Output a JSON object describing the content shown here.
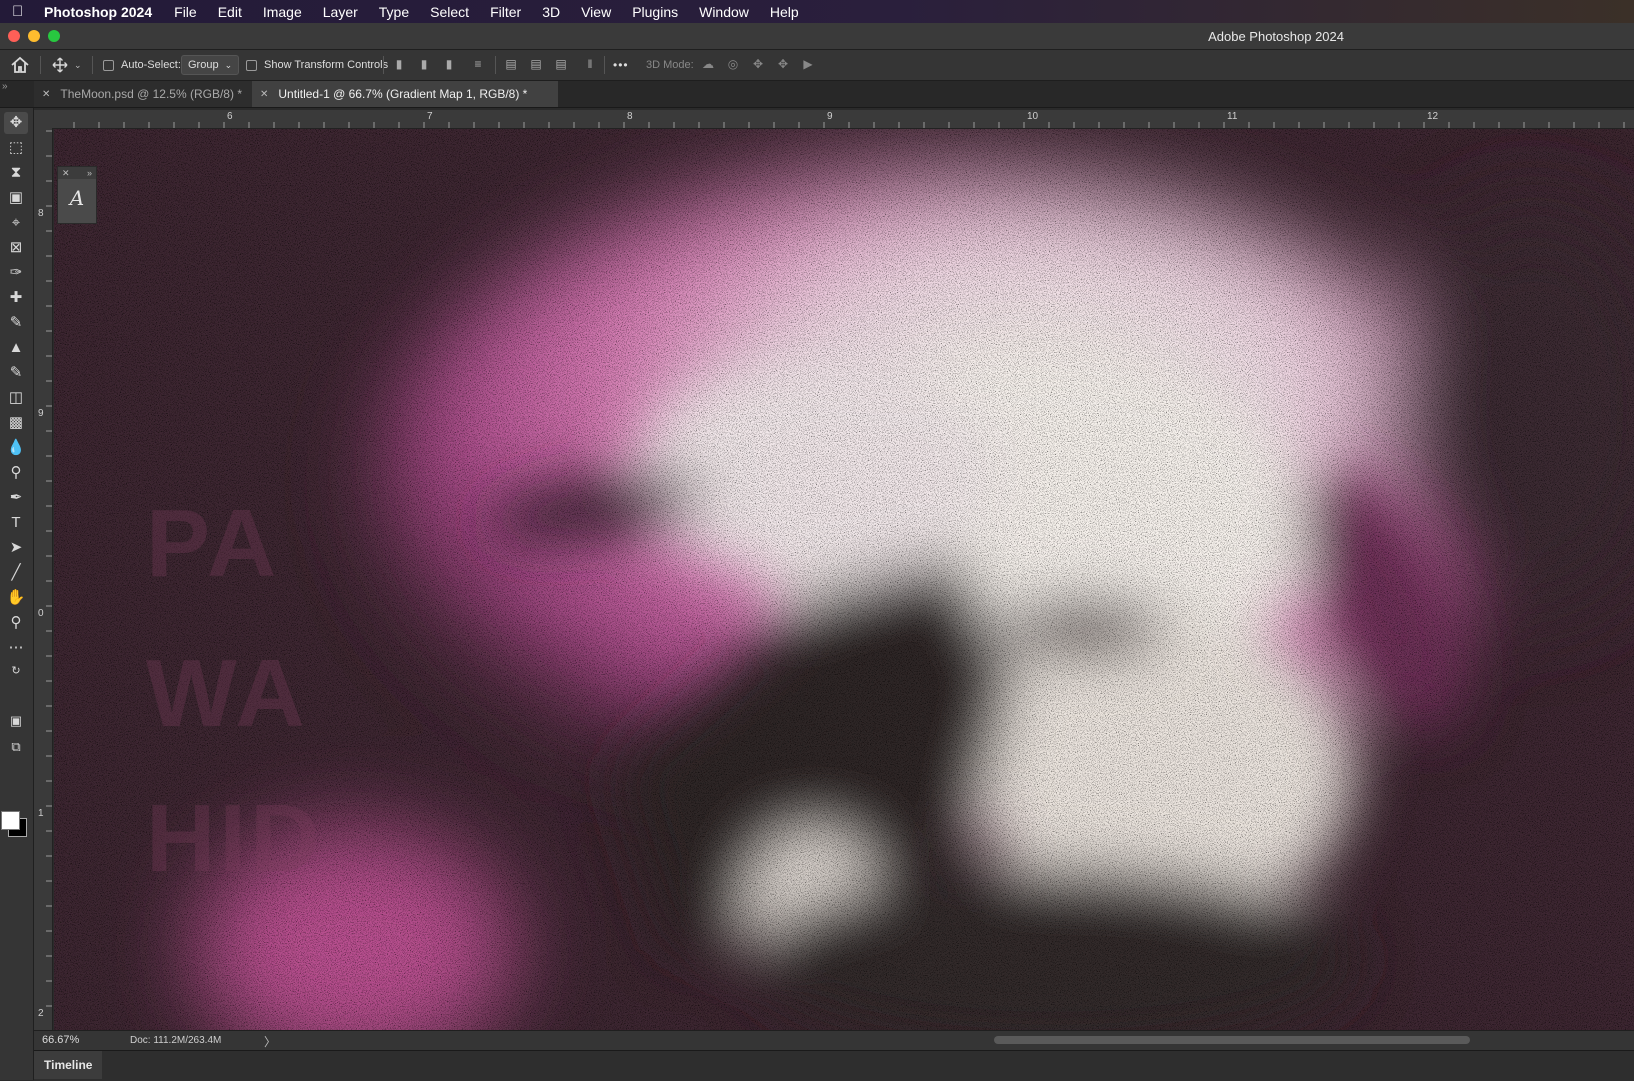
{
  "menubar": {
    "apple_icon": "apple-icon",
    "app_name": "Photoshop 2024",
    "items": [
      "File",
      "Edit",
      "Image",
      "Layer",
      "Type",
      "Select",
      "Filter",
      "3D",
      "View",
      "Plugins",
      "Window",
      "Help"
    ]
  },
  "window": {
    "title": "Adobe Photoshop 2024"
  },
  "options_bar": {
    "auto_select_label": "Auto-Select:",
    "auto_select_value": "Group",
    "show_transform_label": "Show Transform Controls",
    "more_label": "•••",
    "mode_3d_label": "3D Mode:"
  },
  "tabs": [
    {
      "label": "TheMoon.psd @ 12.5% (RGB/8) *",
      "active": false
    },
    {
      "label": "Untitled-1 @ 66.7% (Gradient Map 1, RGB/8) *",
      "active": true
    }
  ],
  "rulers": {
    "h_labels": [
      "6",
      "7",
      "8",
      "9",
      "10",
      "11",
      "12"
    ],
    "v_labels": [
      "8",
      "9",
      "0",
      "1",
      "2"
    ]
  },
  "canvas": {
    "ghost_text": [
      "PA",
      "WA",
      "HID"
    ],
    "mini_panel_glyph": "A"
  },
  "status": {
    "zoom": "66.67%",
    "doc": "Doc: 111.2M/263.4M",
    "arrow": "〉"
  },
  "timeline": {
    "label": "Timeline"
  },
  "colors": {
    "accent_magenta": "#c2569a",
    "highlight_white": "#f2ece6",
    "shadow": "#2e2424"
  }
}
